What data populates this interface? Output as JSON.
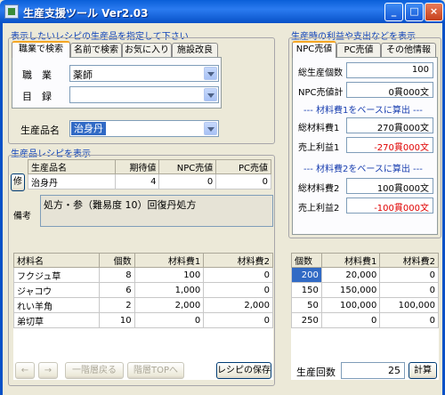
{
  "window": {
    "title": "生産支援ツール Ver2.03",
    "minimize": "_",
    "maximize": "□",
    "close": "×"
  },
  "left_section": {
    "title": "表示したいレシピの生産品を指定して下さい",
    "tabs": [
      "職業で検索",
      "名前で検索",
      "お気に入り",
      "施設改良"
    ],
    "job_label": "職　業",
    "job_value": "薬師",
    "category_label": "目　録",
    "category_value": "",
    "product_label": "生産品名",
    "product_value": "治身丹"
  },
  "recipe_section": {
    "title": "生産品レシピを表示",
    "fix_button": "修",
    "headers": [
      "生産品名",
      "期待値",
      "NPC売値",
      "PC売値"
    ],
    "row": [
      "治身丹",
      "4",
      "0",
      "0"
    ],
    "note_label": "備考",
    "note_text": "処方・参（難易度 10）回復丹処方"
  },
  "materials": {
    "headers": [
      "材料名",
      "個数",
      "材料費1",
      "材料費2"
    ],
    "rows": [
      [
        "フクジュ草",
        "8",
        "100",
        "0"
      ],
      [
        "ジャコウ",
        "6",
        "1,000",
        "0"
      ],
      [
        "れい羊角",
        "2",
        "2,000",
        "2,000"
      ],
      [
        "弟切草",
        "10",
        "0",
        "0"
      ]
    ]
  },
  "bottom_buttons": {
    "back": "←",
    "forward": "→",
    "up_one": "一階層戻る",
    "top": "階層TOPへ",
    "save": "レシピの保存"
  },
  "right_section": {
    "title": "生産時の利益や支出などを表示",
    "tabs": [
      "NPC売値",
      "PC売値",
      "その他情報"
    ],
    "total_count_label": "総生産個数",
    "total_count": "100",
    "npc_total_label": "NPC売値計",
    "npc_total": "0貫000文",
    "note1": "--- 材料費1をベースに算出 ---",
    "cost1_label": "総材料費1",
    "cost1": "270貫000文",
    "profit1_label": "売上利益1",
    "profit1": "-270貫000文",
    "note2": "--- 材料費2をベースに算出 ---",
    "cost2_label": "総材料費2",
    "cost2": "100貫000文",
    "profit2_label": "売上利益2",
    "profit2": "-100貫000文"
  },
  "summary": {
    "headers": [
      "個数",
      "材料費1",
      "材料費2"
    ],
    "rows": [
      [
        "200",
        "20,000",
        "0"
      ],
      [
        "150",
        "150,000",
        "0"
      ],
      [
        "50",
        "100,000",
        "100,000"
      ],
      [
        "250",
        "0",
        "0"
      ]
    ],
    "count_label": "生産回数",
    "count_value": "25",
    "calc_button": "計算"
  }
}
